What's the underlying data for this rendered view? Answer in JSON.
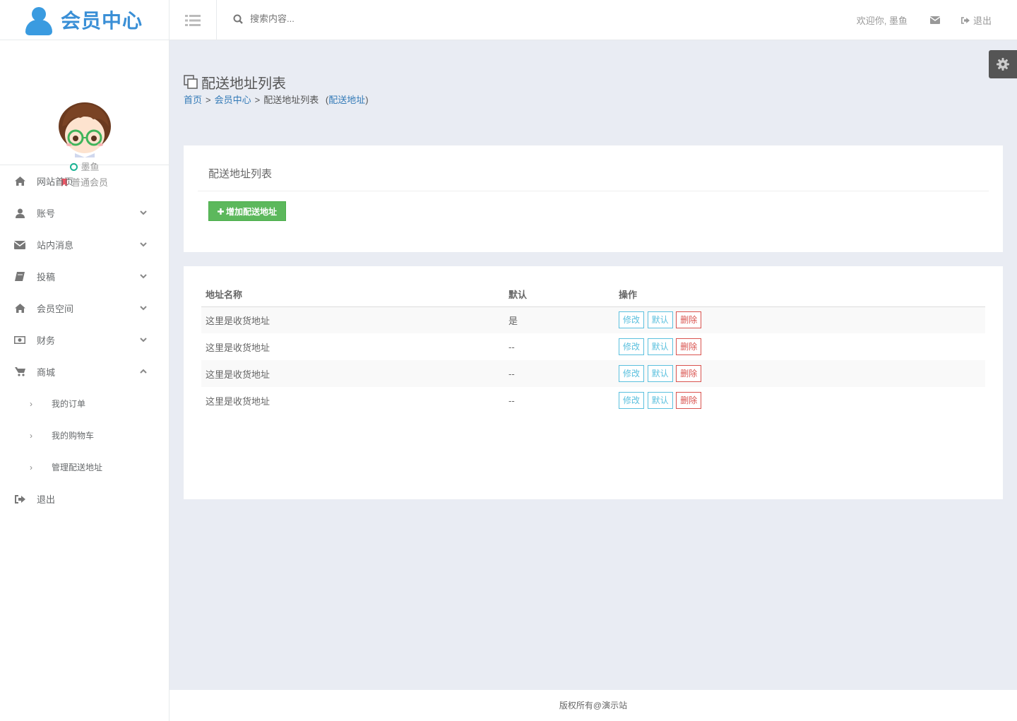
{
  "logo": {
    "text": "会员中心"
  },
  "profile": {
    "name": "墨鱼",
    "level": "普通会员"
  },
  "nav": {
    "items": [
      {
        "label": "网站首页"
      },
      {
        "label": "账号"
      },
      {
        "label": "站内消息"
      },
      {
        "label": "投稿"
      },
      {
        "label": "会员空间"
      },
      {
        "label": "财务"
      },
      {
        "label": "商城"
      },
      {
        "label": "退出"
      }
    ],
    "sub_items": [
      {
        "label": "我的订单"
      },
      {
        "label": "我的购物车"
      },
      {
        "label": "管理配送地址"
      }
    ]
  },
  "topbar": {
    "search_placeholder": "搜索内容...",
    "welcome": "欢迎你, 墨鱼",
    "logout": "退出"
  },
  "page": {
    "title": "配送地址列表",
    "breadcrumb": {
      "home": "首页",
      "sep": ">",
      "member": "会员中心",
      "current": "配送地址列表",
      "paren_open": "(",
      "link": "配送地址",
      "paren_close": ")"
    }
  },
  "panel1": {
    "title": "配送地址列表",
    "add_button": "增加配送地址"
  },
  "table": {
    "headers": [
      "地址名称",
      "默认",
      "操作"
    ],
    "rows": [
      {
        "name": "这里是收货地址",
        "default": "是"
      },
      {
        "name": "这里是收货地址",
        "default": "--"
      },
      {
        "name": "这里是收货地址",
        "default": "--"
      },
      {
        "name": "这里是收货地址",
        "default": "--"
      }
    ],
    "actions": {
      "edit": "修改",
      "set_default": "默认",
      "delete": "删除"
    }
  },
  "footer": {
    "text": "版权所有@演示站"
  },
  "colors": {
    "brand_blue": "#3a8fd6",
    "success": "#5cb85c",
    "info": "#5bc0de",
    "danger": "#d9534f",
    "bg": "#e9ecf3"
  }
}
